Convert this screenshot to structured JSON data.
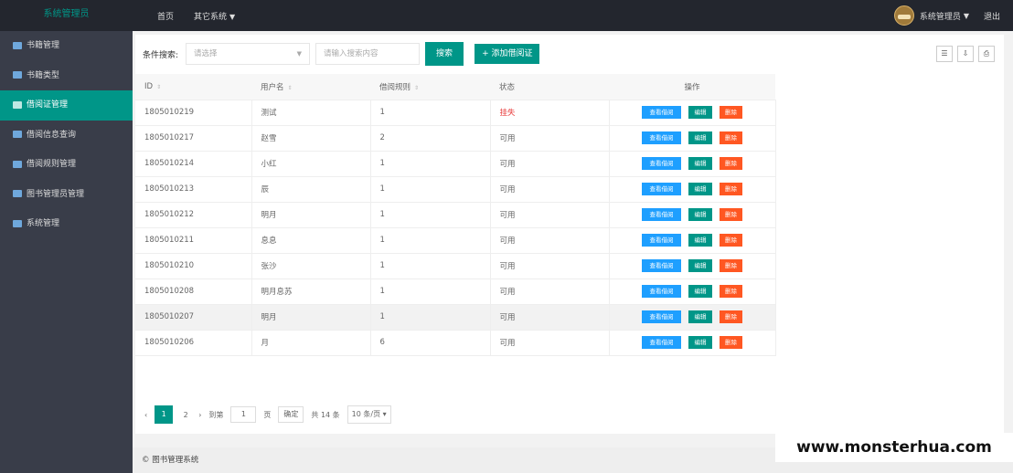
{
  "app": {
    "logo": "系统管理员"
  },
  "topnav": {
    "home": "首页",
    "other": "其它系统"
  },
  "user": {
    "name": "系统管理员",
    "logout": "退出"
  },
  "sidebar": {
    "items": [
      {
        "label": "书籍管理"
      },
      {
        "label": "书籍类型"
      },
      {
        "label": "借阅证管理"
      },
      {
        "label": "借阅信息查询"
      },
      {
        "label": "借阅规则管理"
      },
      {
        "label": "图书管理员管理"
      },
      {
        "label": "系统管理"
      }
    ]
  },
  "search": {
    "label": "条件搜索:",
    "select_placeholder": "请选择",
    "input_placeholder": "请输入搜索内容",
    "button": "搜索",
    "add_button": "+ 添加借阅证"
  },
  "table": {
    "headers": [
      "ID",
      "用户名",
      "借阅规则",
      "状态",
      "操作"
    ],
    "actions": {
      "view": "查看借阅",
      "edit": "编辑",
      "delete": "删除"
    },
    "rows": [
      {
        "id": "1805010219",
        "user": "测试",
        "rule": "1",
        "status": "挂失"
      },
      {
        "id": "1805010217",
        "user": "赵雪",
        "rule": "2",
        "status": "可用"
      },
      {
        "id": "1805010214",
        "user": "小红",
        "rule": "1",
        "status": "可用"
      },
      {
        "id": "1805010213",
        "user": "辰",
        "rule": "1",
        "status": "可用"
      },
      {
        "id": "1805010212",
        "user": "明月",
        "rule": "1",
        "status": "可用"
      },
      {
        "id": "1805010211",
        "user": "息息",
        "rule": "1",
        "status": "可用"
      },
      {
        "id": "1805010210",
        "user": "张沙",
        "rule": "1",
        "status": "可用"
      },
      {
        "id": "1805010208",
        "user": "明月息苏",
        "rule": "1",
        "status": "可用"
      },
      {
        "id": "1805010207",
        "user": "明月",
        "rule": "1",
        "status": "可用"
      },
      {
        "id": "1805010206",
        "user": "月",
        "rule": "6",
        "status": "可用"
      }
    ]
  },
  "pager": {
    "prev": "‹",
    "page1": "1",
    "page2": "2",
    "next": "›",
    "goto": "到第",
    "page_value": "1",
    "page_unit": "页",
    "confirm": "确定",
    "total": "共 14 条",
    "size": "10 条/页"
  },
  "footer": {
    "text": "© 图书管理系统"
  },
  "watermark": "www.monsterhua.com"
}
